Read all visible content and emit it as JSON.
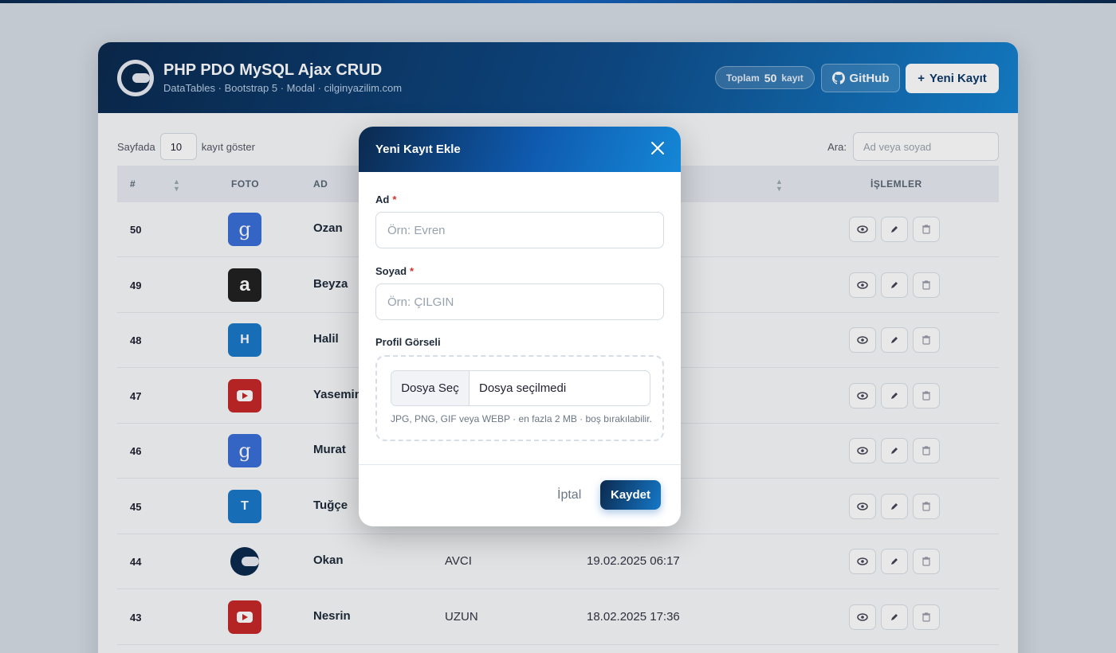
{
  "header": {
    "title": "PHP PDO MySQL Ajax CRUD",
    "subtitle": "DataTables · Bootstrap 5 · Modal · cilginyazilim.com",
    "count_prefix": "Toplam",
    "count_value": "50",
    "count_suffix": "kayıt",
    "github_label": "GitHub",
    "new_label": "Yeni Kayıt",
    "new_icon": "+"
  },
  "toolbar": {
    "length_prefix": "Sayfada",
    "length_value": "10",
    "length_suffix": "kayıt göster",
    "search_label": "Ara:",
    "search_placeholder": "Ad veya soyad"
  },
  "table": {
    "headers": [
      "#",
      "FOTO",
      "AD",
      "İŞLEMLER"
    ],
    "rows": [
      {
        "id": "50",
        "name": "Ozan",
        "surname": "",
        "date": "",
        "image": "google",
        "color": "#3b6fd8",
        "letter": "g"
      },
      {
        "id": "49",
        "name": "Beyza",
        "surname": "",
        "date": "",
        "image": "amazon",
        "color": "#222",
        "letter": "a"
      },
      {
        "id": "48",
        "name": "Halil",
        "surname": "",
        "date": "",
        "image": "letter",
        "color": "#1a79c9",
        "letter": "H"
      },
      {
        "id": "47",
        "name": "Yasemin",
        "surname": "",
        "date": "",
        "image": "youtube",
        "color": "#c62828",
        "letter": "▶"
      },
      {
        "id": "46",
        "name": "Murat",
        "surname": "",
        "date": "",
        "image": "google",
        "color": "#3b6fd8",
        "letter": "g"
      },
      {
        "id": "45",
        "name": "Tuğçe",
        "surname": "",
        "date": "",
        "image": "letter",
        "color": "#1a79c9",
        "letter": "T"
      },
      {
        "id": "44",
        "name": "Okan",
        "surname": "AVCI",
        "date": "19.02.2025 06:17",
        "image": "logo",
        "color": "#0b2a4f",
        "letter": ""
      },
      {
        "id": "43",
        "name": "Nesrin",
        "surname": "UZUN",
        "date": "18.02.2025 17:36",
        "image": "youtube",
        "color": "#c62828",
        "letter": "▶"
      }
    ]
  },
  "modal": {
    "title": "Yeni Kayıt Ekle",
    "name_label": "Ad",
    "name_placeholder": "Örn: Evren",
    "surname_label": "Soyad",
    "surname_placeholder": "Örn: ÇILGIN",
    "required_mark": "*",
    "photo_label": "Profil Görseli",
    "file_button": "Dosya Seç",
    "file_status": "Dosya seçilmedi",
    "hint": "JPG, PNG, GIF veya WEBP · en fazla 2 MB · boş bırakılabilir.",
    "cancel_label": "İptal",
    "save_label": "Kaydet"
  }
}
